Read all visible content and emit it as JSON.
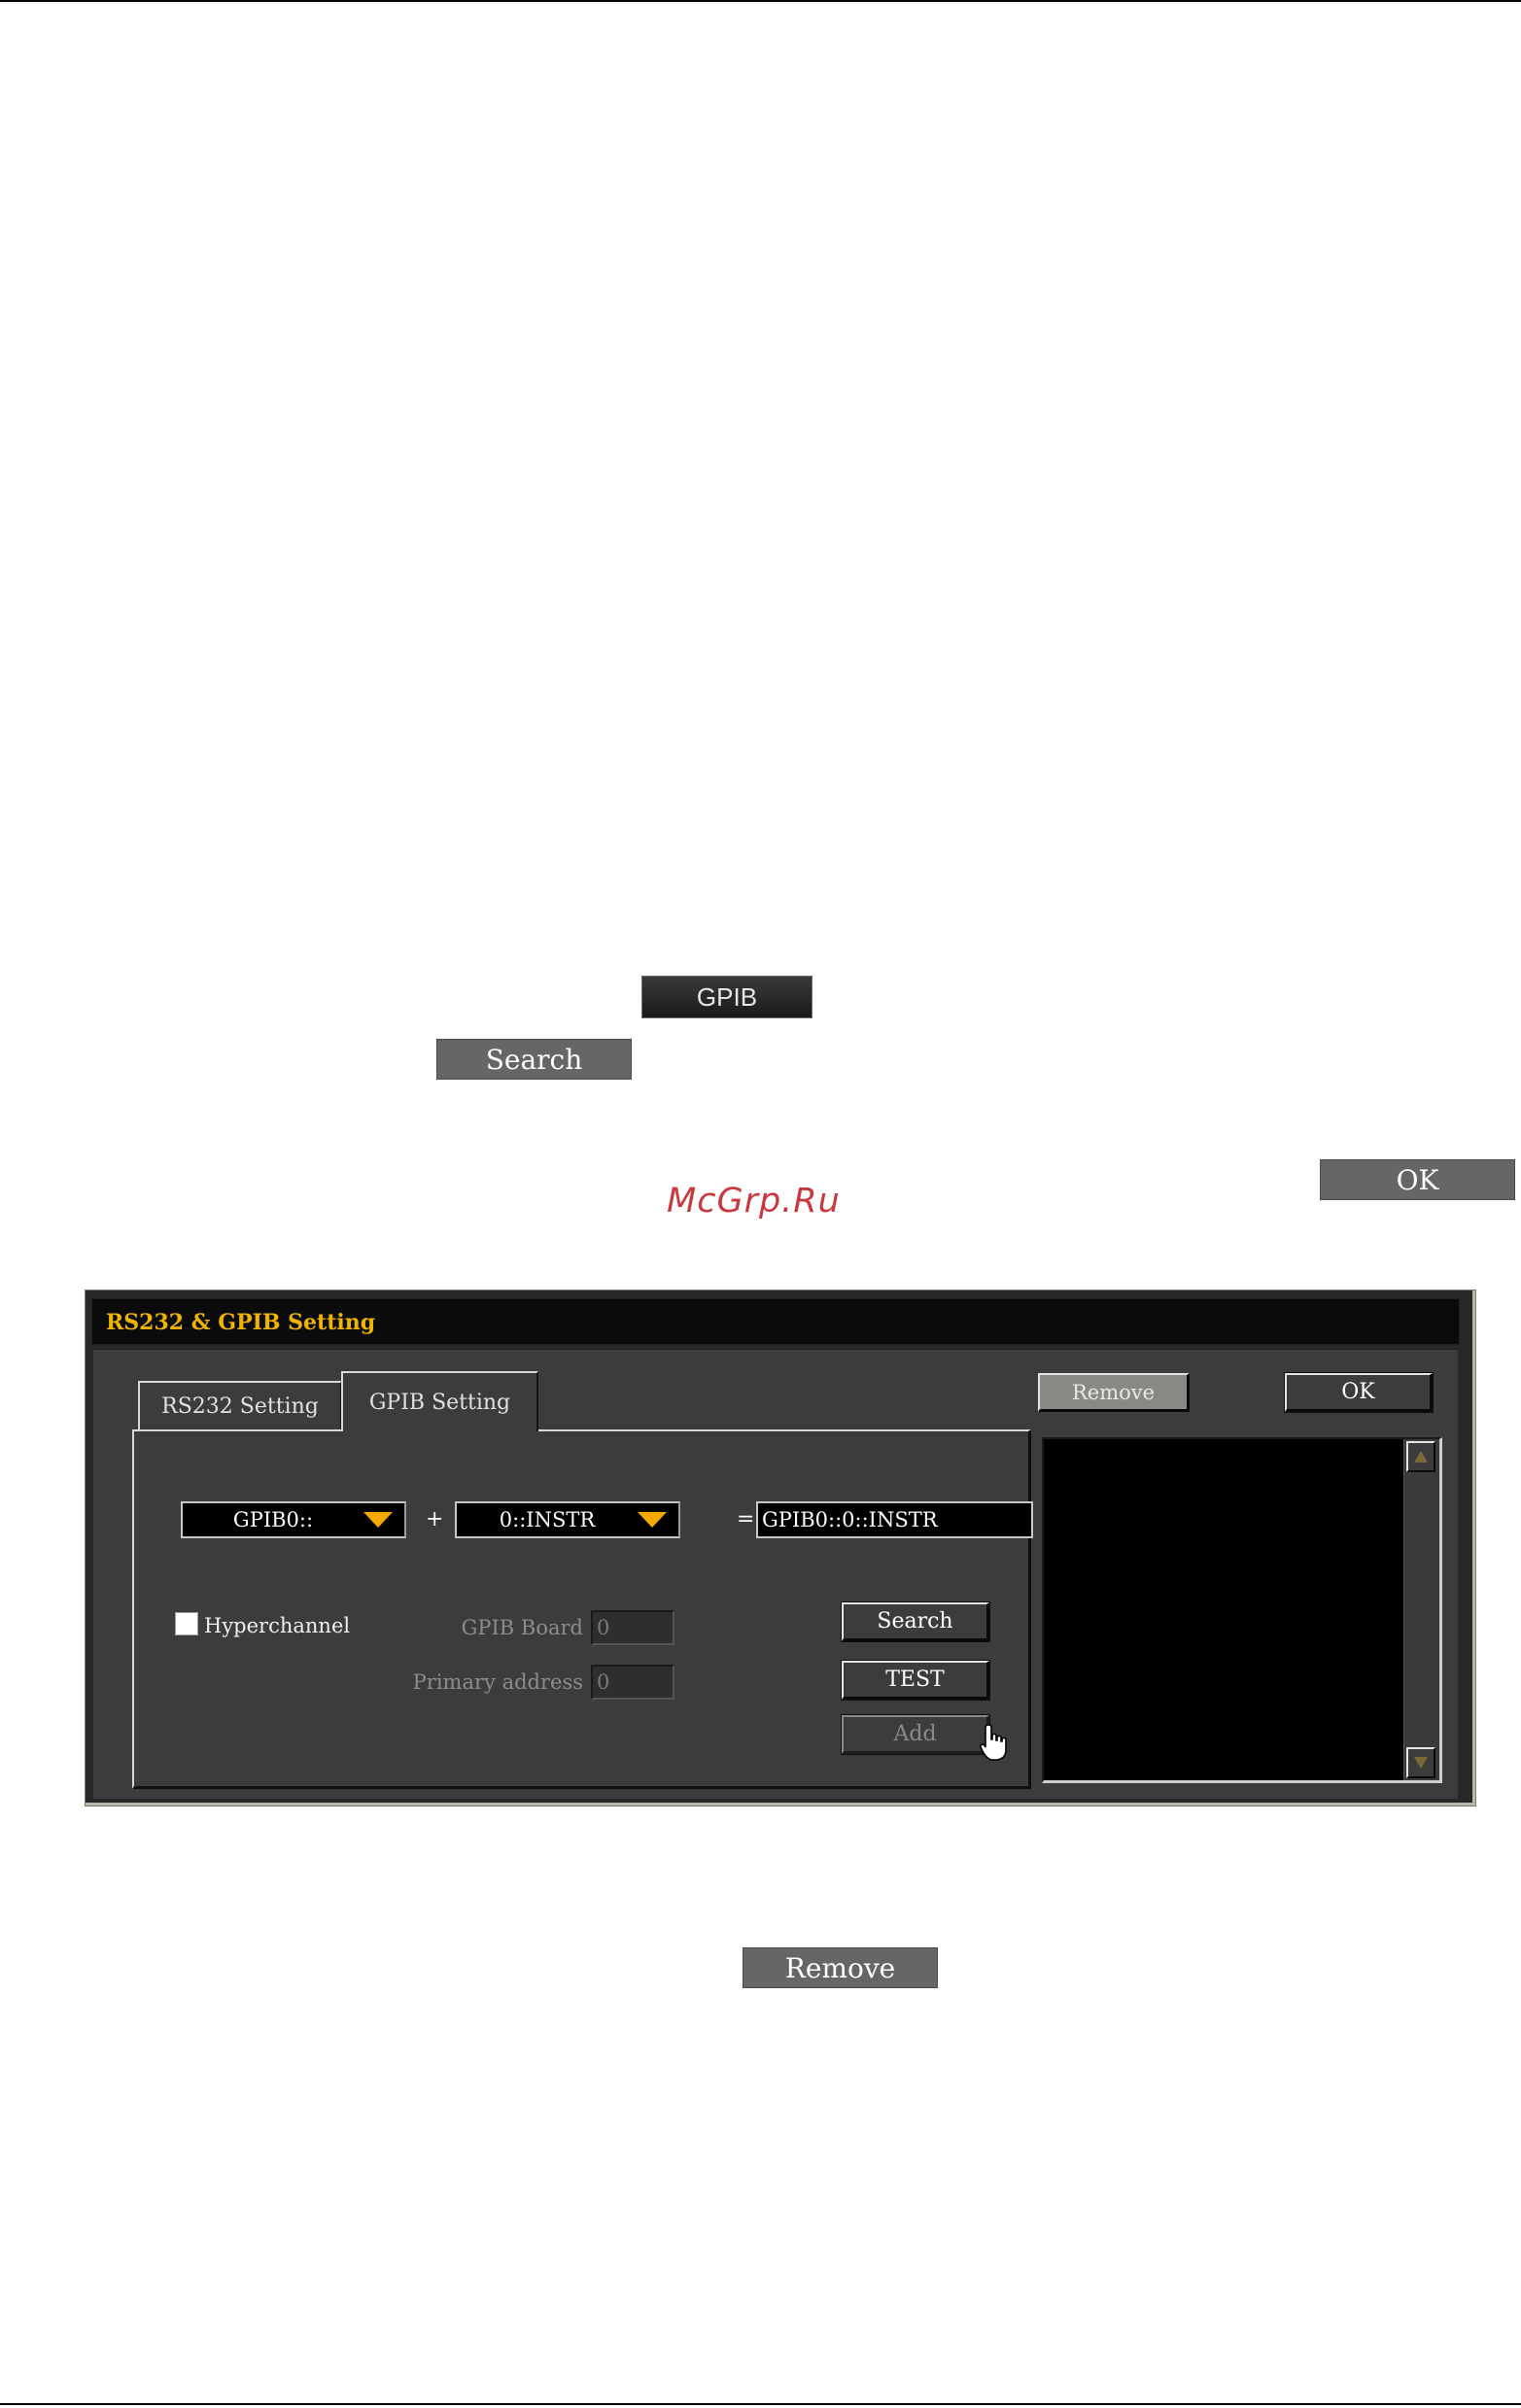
{
  "inline_buttons": {
    "gpib_label": "GPIB",
    "search_label": "Search",
    "ok_label": "OK",
    "remove_label": "Remove"
  },
  "watermark": "McGrp.Ru",
  "dialog": {
    "title": "RS232 & GPIB Setting",
    "tabs": [
      {
        "label": "RS232 Setting",
        "active": false
      },
      {
        "label": "GPIB Setting",
        "active": true
      }
    ],
    "interface_combo": {
      "value": "GPIB0::"
    },
    "plus_sign": "+",
    "address_combo": {
      "value": "0::INSTR"
    },
    "equals_sign": "=",
    "resource_string": "GPIB0::0::INSTR",
    "hyperchannel": {
      "label": "Hyperchannel",
      "checked": false
    },
    "gpib_board": {
      "label": "GPIB Board",
      "value": "0"
    },
    "primary_address": {
      "label": "Primary address",
      "value": "0"
    },
    "buttons": {
      "search": "Search",
      "test": "TEST",
      "add": "Add",
      "remove": "Remove",
      "ok": "OK"
    },
    "colors": {
      "title_text": "#f0b400",
      "combo_arrow": "#f5a800",
      "dialog_bg": "#3c3c3c"
    }
  }
}
